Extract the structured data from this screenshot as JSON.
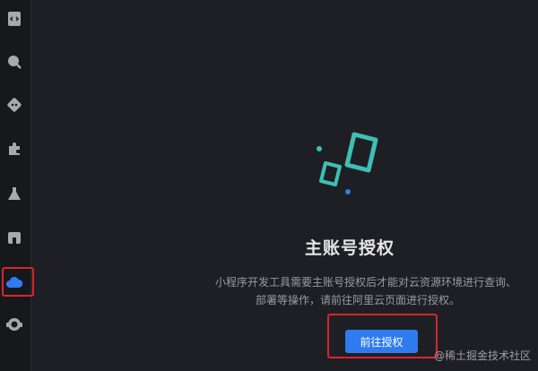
{
  "activity_bar": {
    "items": [
      {
        "icon": "code-file-icon"
      },
      {
        "icon": "search-icon"
      },
      {
        "icon": "git-icon"
      },
      {
        "icon": "extensions-icon"
      },
      {
        "icon": "test-flask-icon"
      },
      {
        "icon": "storage-icon"
      },
      {
        "icon": "cloud-icon",
        "active": true
      },
      {
        "icon": "support-icon"
      }
    ]
  },
  "auth_panel": {
    "title": "主账号授权",
    "description_line1": "小程序开发工具需要主账号授权后才能对云资源环境进行查询、",
    "description_line2": "部署等操作，请前往阿里云页面进行授权。",
    "button_label": "前往授权"
  },
  "watermark": "@稀土掘金技术社区",
  "colors": {
    "accent": "#2f7bef",
    "highlight": "#d8262c",
    "logo_teal": "#3dbfb4",
    "logo_blue": "#2f7bef"
  }
}
